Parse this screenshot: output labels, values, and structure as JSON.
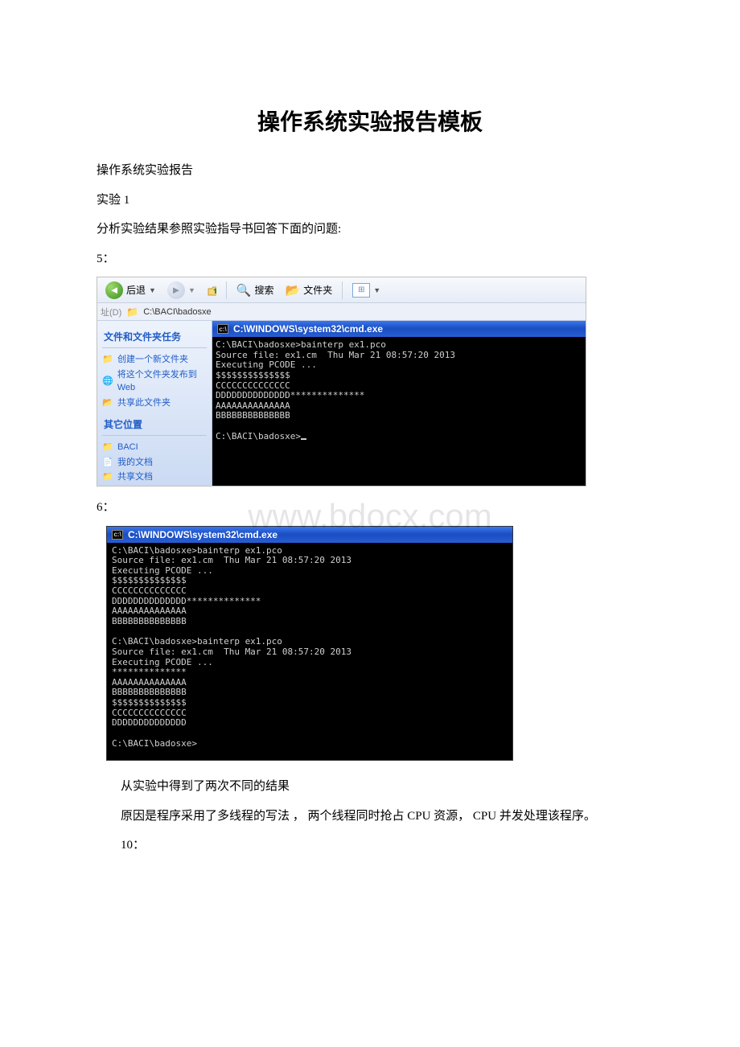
{
  "doc_title": "操作系统实验报告模板",
  "p1": "操作系统实验报告",
  "p2": "实验 1",
  "p3": "分析实验结果参照实验指导书回答下面的问题:",
  "p4": "5：",
  "p5": "6：",
  "p6": "从实验中得到了两次不同的结果",
  "p7": "原因是程序采用了多线程的写法 ，  两个线程同时抢占 CPU 资源，  CPU 并发处理该程序。",
  "p8": "10：",
  "watermark": "www.bdocx.com",
  "shot1": {
    "toolbar": {
      "back_label": "后退",
      "search_label": "搜索",
      "folders_label": "文件夹"
    },
    "addr": {
      "label": "址(D)",
      "path": "C:\\BACI\\badosxe"
    },
    "tasks_head": "文件和文件夹任务",
    "tasks": [
      {
        "label": "创建一个新文件夹"
      },
      {
        "label": "将这个文件夹发布到 Web"
      },
      {
        "label": "共享此文件夹"
      }
    ],
    "other_head": "其它位置",
    "other": [
      {
        "label": "BACI"
      },
      {
        "label": "我的文档"
      },
      {
        "label": "共享文档"
      }
    ],
    "cmd_title": "C:\\WINDOWS\\system32\\cmd.exe",
    "cmd_lines": "C:\\BACI\\badosxe>bainterp ex1.pco\nSource file: ex1.cm  Thu Mar 21 08:57:20 2013\nExecuting PCODE ...\n$$$$$$$$$$$$$$\nCCCCCCCCCCCCCC\nDDDDDDDDDDDDDD**************\nAAAAAAAAAAAAAA\nBBBBBBBBBBBBBB\n\nC:\\BACI\\badosxe>"
  },
  "shot2": {
    "cmd_title": "C:\\WINDOWS\\system32\\cmd.exe",
    "cmd_lines": "C:\\BACI\\badosxe>bainterp ex1.pco\nSource file: ex1.cm  Thu Mar 21 08:57:20 2013\nExecuting PCODE ...\n$$$$$$$$$$$$$$\nCCCCCCCCCCCCCC\nDDDDDDDDDDDDDD**************\nAAAAAAAAAAAAAA\nBBBBBBBBBBBBBB\n\nC:\\BACI\\badosxe>bainterp ex1.pco\nSource file: ex1.cm  Thu Mar 21 08:57:20 2013\nExecuting PCODE ...\n**************\nAAAAAAAAAAAAAA\nBBBBBBBBBBBBBB\n$$$$$$$$$$$$$$\nCCCCCCCCCCCCCC\nDDDDDDDDDDDDDD\n\nC:\\BACI\\badosxe>"
  }
}
